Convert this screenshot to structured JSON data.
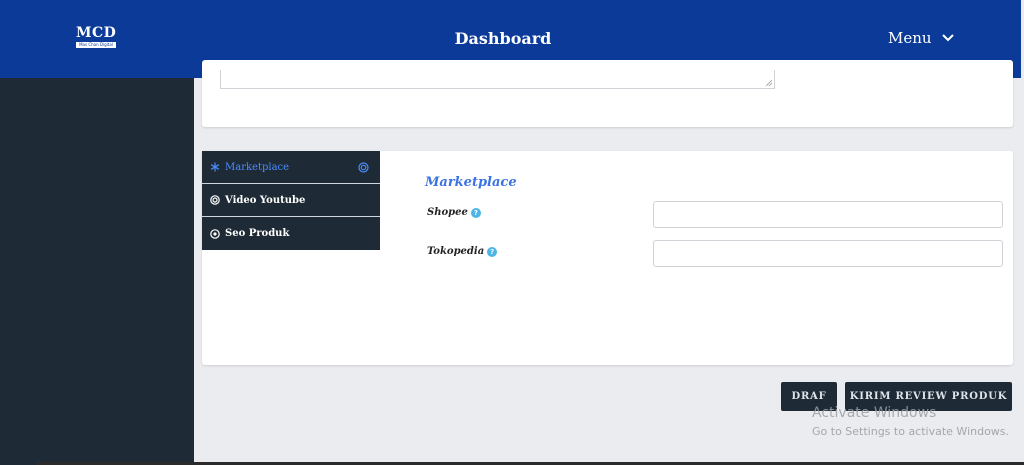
{
  "header": {
    "logo_main": "MCD",
    "logo_sub": "Mas Chan Digital",
    "title": "Dashboard",
    "menu_label": "Menu"
  },
  "tabs": [
    {
      "label": "Marketplace",
      "icon": "snowflake-icon",
      "active": true
    },
    {
      "label": "Video Youtube",
      "icon": "target-icon",
      "active": false
    },
    {
      "label": "Seo Produk",
      "icon": "circle-dot-icon",
      "active": false
    }
  ],
  "marketplace": {
    "title": "Marketplace",
    "fields": [
      {
        "label": "Shopee",
        "value": "",
        "help_icon": "question-icon"
      },
      {
        "label": "Tokopedia",
        "value": "",
        "help_icon": "question-icon"
      }
    ]
  },
  "actions": {
    "draf_label": "DRAF",
    "kirim_label": "KIRIM REVIEW PRODUK"
  },
  "watermark": {
    "line1": "Activate Windows",
    "line2": "Go to Settings to activate Windows."
  },
  "colors": {
    "header_bg": "#0b3a99",
    "sidebar_bg": "#1e2a35",
    "accent": "#3b73e0",
    "help_icon": "#4cb5e6"
  }
}
